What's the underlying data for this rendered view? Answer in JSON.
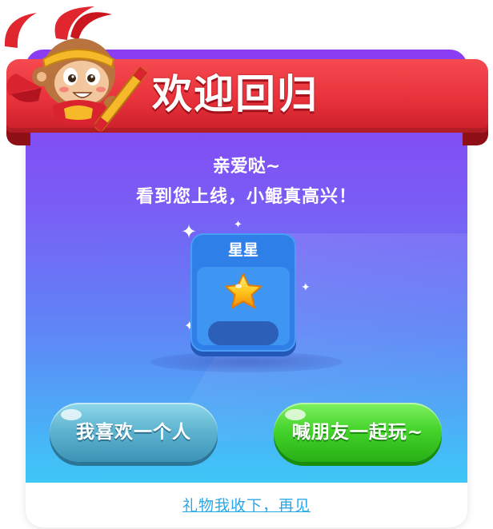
{
  "header": {
    "title": "欢迎回归"
  },
  "greeting": {
    "line1": "亲爱哒~",
    "line2": "看到您上线，小鲲真高兴！"
  },
  "reward": {
    "name": "星星",
    "icon": "star-icon",
    "count": ""
  },
  "buttons": {
    "left_label": "我喜欢一个人",
    "right_label": "喊朋友一起玩~"
  },
  "footer": {
    "link_label": "礼物我收下，再见"
  },
  "colors": {
    "ribbon": "#e8323b",
    "panel_top": "#8a3cf2",
    "panel_bottom": "#3ec8f7",
    "left_button": "#5db3cf",
    "right_button": "#43d22a",
    "link": "#2aa8e8"
  }
}
